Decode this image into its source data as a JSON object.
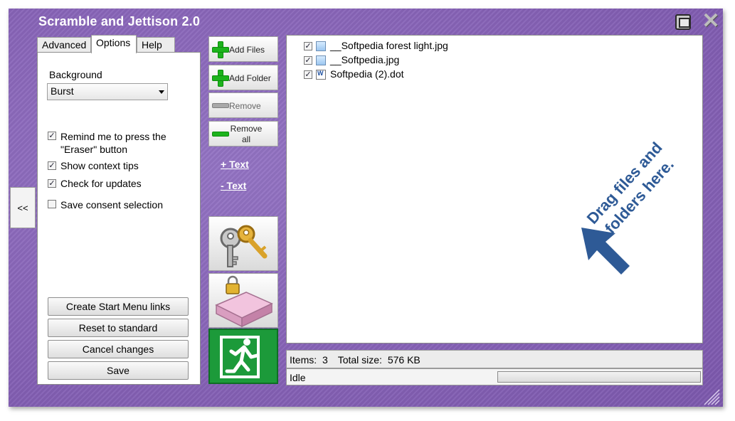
{
  "window": {
    "title": "Scramble and Jettison 2.0",
    "accent_bg": "#8763b8",
    "collapse_label": "<<"
  },
  "tabs": [
    {
      "label": "Advanced",
      "active": false
    },
    {
      "label": "Options",
      "active": true
    },
    {
      "label": "Help",
      "active": false
    }
  ],
  "options": {
    "background_label": "Background",
    "background_value": "Burst",
    "checkboxes": [
      {
        "label": "Remind me to press the \"Eraser\" button",
        "checked": true
      },
      {
        "label": "Show context tips",
        "checked": true
      },
      {
        "label": "Check for updates",
        "checked": true
      },
      {
        "label": "Save consent selection",
        "checked": false
      }
    ],
    "buttons": {
      "create_start_menu": "Create Start Menu links",
      "reset": "Reset to standard",
      "cancel": "Cancel changes",
      "save": "Save"
    }
  },
  "toolbar": {
    "add_files": "Add Files",
    "add_folder": "Add Folder",
    "remove": "Remove",
    "remove_all_line1": "Remove",
    "remove_all_line2": "all",
    "plus_text": "+  Text",
    "minus_text": "-  Text",
    "icons": [
      "plus-icon",
      "plus-icon",
      "minus-icon",
      "minus-icon",
      "keys-icon",
      "eraser-lock-icon",
      "exit-icon"
    ]
  },
  "files": [
    {
      "name": "__Softpedia forest light.jpg",
      "checked": true,
      "icon": "image-icon"
    },
    {
      "name": "__Softpedia.jpg",
      "checked": true,
      "icon": "image-icon"
    },
    {
      "name": "Softpedia (2).dot",
      "checked": true,
      "icon": "word-doc-icon"
    }
  ],
  "drag_hint": {
    "line1": "Drag files and",
    "line2": "folders here."
  },
  "status": {
    "items_label": "Items:",
    "items_count": "3",
    "total_label": "Total size:",
    "total_size": "576 KB",
    "state": "Idle",
    "progress": 0
  },
  "colors": {
    "green": "#1db31d",
    "exit_green": "#1c9a3a",
    "drag_blue": "#2e5a96"
  }
}
